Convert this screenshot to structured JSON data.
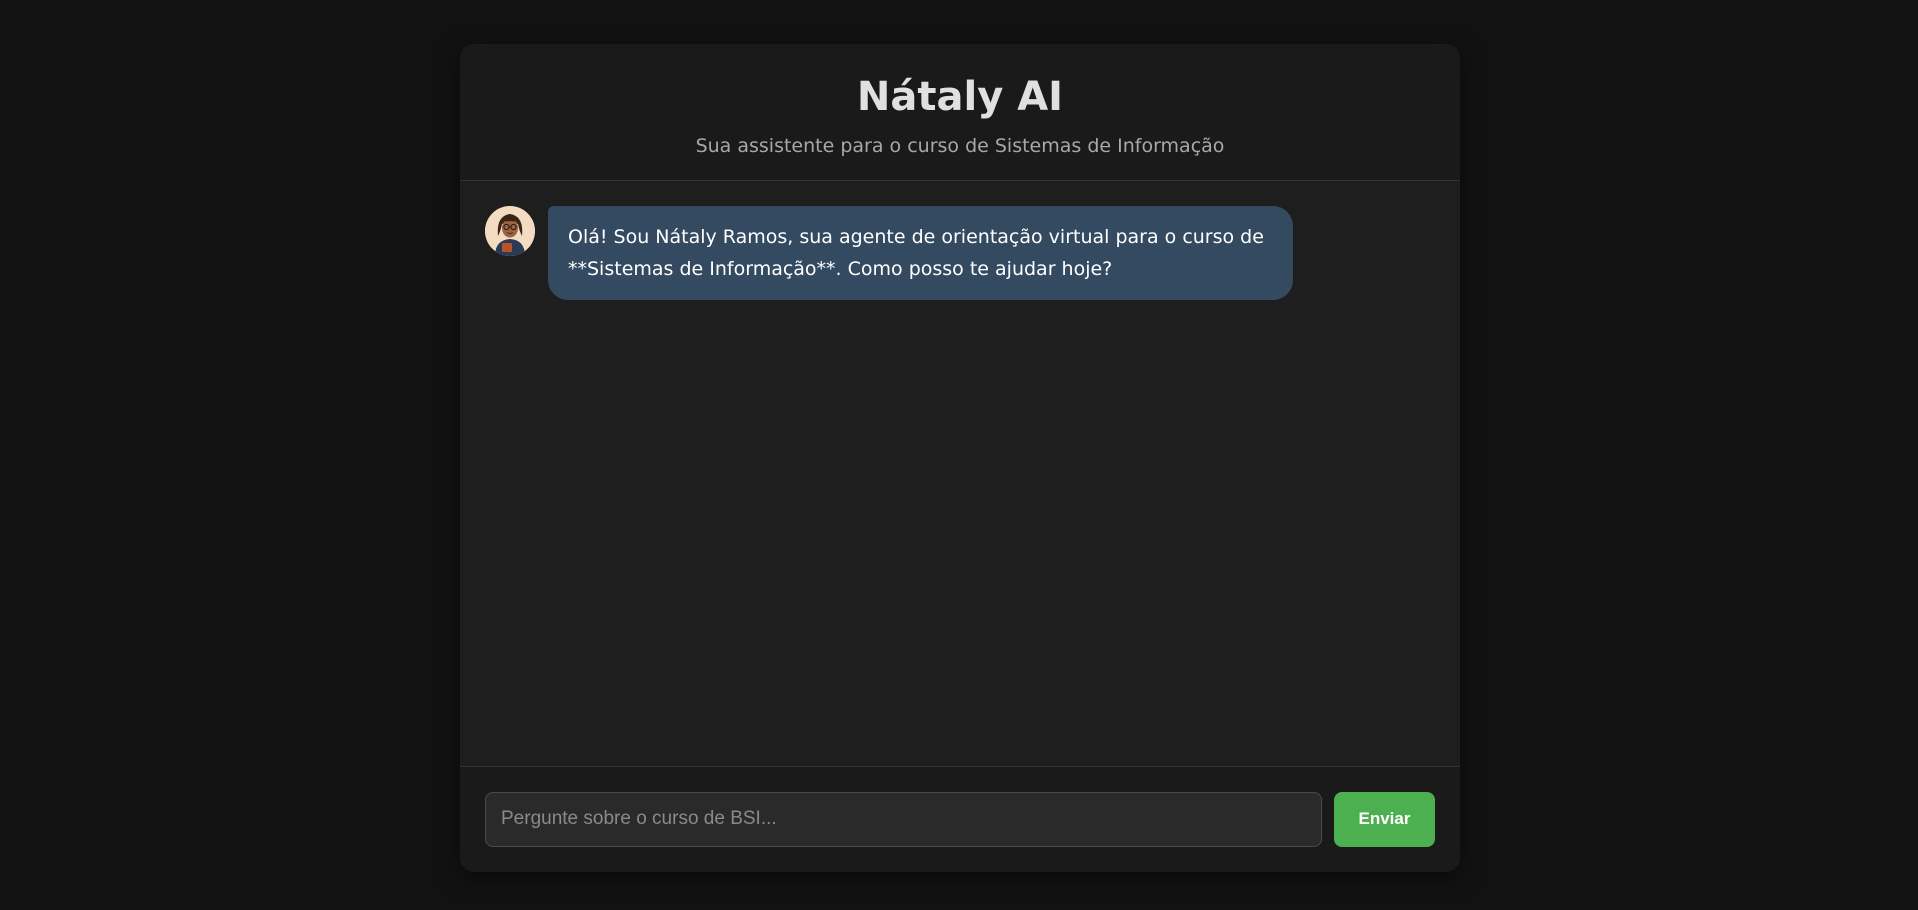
{
  "header": {
    "title": "Nátaly AI",
    "subtitle": "Sua assistente para o curso de Sistemas de Informação"
  },
  "messages": [
    {
      "sender": "bot",
      "avatar_icon": "assistant-avatar-icon",
      "text": "Olá! Sou Nátaly Ramos, sua agente de orientação virtual para o curso de **Sistemas de Informação**. Como posso te ajudar hoje?"
    }
  ],
  "composer": {
    "placeholder": "Pergunte sobre o curso de BSI...",
    "value": "",
    "send_label": "Enviar"
  },
  "colors": {
    "page_background": "#121212",
    "panel_background": "#1e1e1e",
    "bot_bubble": "#344a60",
    "send_button": "#4caf50"
  }
}
